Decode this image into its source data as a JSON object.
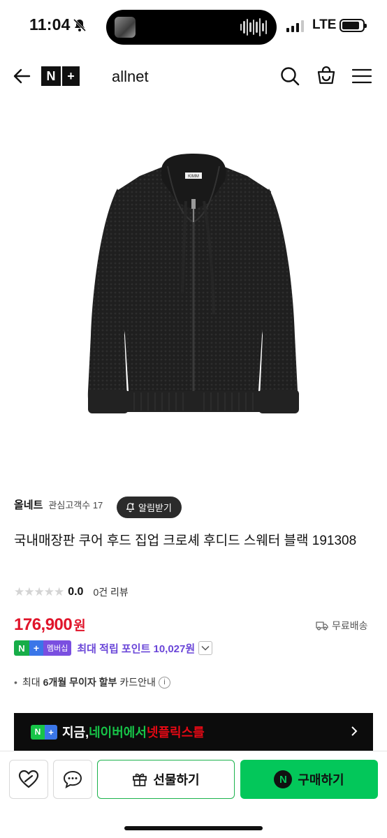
{
  "status_bar": {
    "time": "11:04",
    "network": "LTE"
  },
  "header": {
    "store_name": "allnet",
    "logo_n": "N",
    "logo_plus": "+"
  },
  "product": {
    "image_brand_tag": "KIMM",
    "seller": "올네트",
    "favorites_label": "관심고객수 17",
    "alarm_button": "알림받기",
    "title": "국내매장판 쿠어 후드 집업 크로셰 후디드 스웨터 블랙 191308",
    "rating": "0.0",
    "rating_stars": 0,
    "reviews": "0건 리뷰",
    "price": "176,900",
    "price_unit": "원",
    "shipping": "무료배송",
    "membership_badge": "멤버십",
    "points": "최대 적립 포인트 10,027원",
    "card_prefix": "최대",
    "card_bold": "6개월 무이자 할부",
    "card_suffix": "카드안내"
  },
  "promo": {
    "now": "지금, ",
    "naver": "네이버에서 ",
    "netflix": "넷플릭스를"
  },
  "bottom_bar": {
    "gift_label": "선물하기",
    "buy_label": "구매하기",
    "buy_icon": "N"
  },
  "colors": {
    "price_red": "#e0142a",
    "naver_green": "#03c75a",
    "points_purple": "#6a46d8",
    "promo_bg": "#0c0c0c"
  },
  "icons": [
    "back-arrow",
    "search",
    "shopping-bag",
    "hamburger-menu",
    "bell-plus",
    "delivery-truck",
    "heart-zzim",
    "chat-bubble",
    "gift-box",
    "chevron-right",
    "chevron-down",
    "info"
  ]
}
